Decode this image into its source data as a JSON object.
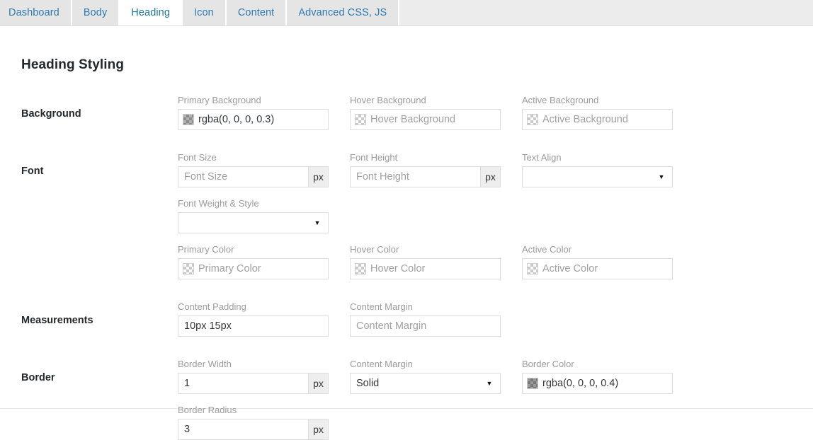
{
  "tabs": [
    {
      "label": "Dashboard",
      "active": false
    },
    {
      "label": "Body",
      "active": false
    },
    {
      "label": "Heading",
      "active": true
    },
    {
      "label": "Icon",
      "active": false
    },
    {
      "label": "Content",
      "active": false
    },
    {
      "label": "Advanced CSS, JS",
      "active": false
    }
  ],
  "page": {
    "title": "Heading Styling"
  },
  "sections": {
    "background": {
      "label": "Background",
      "primary": {
        "label": "Primary Background",
        "value": "rgba(0, 0, 0, 0.3)",
        "placeholder": "Primary Background",
        "swatch": "rgba(0, 0, 0, 0.3)",
        "filled": true
      },
      "hover": {
        "label": "Hover Background",
        "value": "",
        "placeholder": "Hover Background",
        "swatch": "transparent",
        "filled": false
      },
      "active": {
        "label": "Active Background",
        "value": "",
        "placeholder": "Active Background",
        "swatch": "transparent",
        "filled": false
      }
    },
    "font": {
      "label": "Font",
      "font_size": {
        "label": "Font Size",
        "value": "",
        "placeholder": "Font Size",
        "unit": "px"
      },
      "font_height": {
        "label": "Font Height",
        "value": "",
        "placeholder": "Font Height",
        "unit": "px"
      },
      "text_align": {
        "label": "Text Align",
        "value": "",
        "caret": "▼"
      },
      "font_weight": {
        "label": "Font Weight & Style",
        "value": "",
        "caret": "▼"
      },
      "primary_color": {
        "label": "Primary Color",
        "value": "",
        "placeholder": "Primary Color",
        "swatch": "transparent",
        "filled": false
      },
      "hover_color": {
        "label": "Hover Color",
        "value": "",
        "placeholder": "Hover Color",
        "swatch": "transparent",
        "filled": false
      },
      "active_color": {
        "label": "Active Color",
        "value": "",
        "placeholder": "Active Color",
        "swatch": "transparent",
        "filled": false
      }
    },
    "measurements": {
      "label": "Measurements",
      "content_padding": {
        "label": "Content Padding",
        "value": "10px 15px",
        "placeholder": "Content Padding"
      },
      "content_margin": {
        "label": "Content Margin",
        "value": "",
        "placeholder": "Content Margin"
      }
    },
    "border": {
      "label": "Border",
      "border_width": {
        "label": "Border Width",
        "value": "1",
        "placeholder": "Border Width",
        "unit": "px"
      },
      "border_style": {
        "label": "Content Margin",
        "value": "Solid",
        "caret": "▼"
      },
      "border_color": {
        "label": "Border Color",
        "value": "rgba(0, 0, 0, 0.4)",
        "placeholder": "Border Color",
        "swatch": "rgba(0, 0, 0, 0.4)",
        "filled": true
      },
      "border_radius": {
        "label": "Border Radius",
        "value": "3",
        "placeholder": "Border Radius",
        "unit": "px"
      }
    }
  },
  "colors": {
    "tab_link": "#2e7ab0",
    "tabbar_bg": "#ececec",
    "label_gray": "#9b9b9b",
    "text_dark": "#32373c"
  }
}
